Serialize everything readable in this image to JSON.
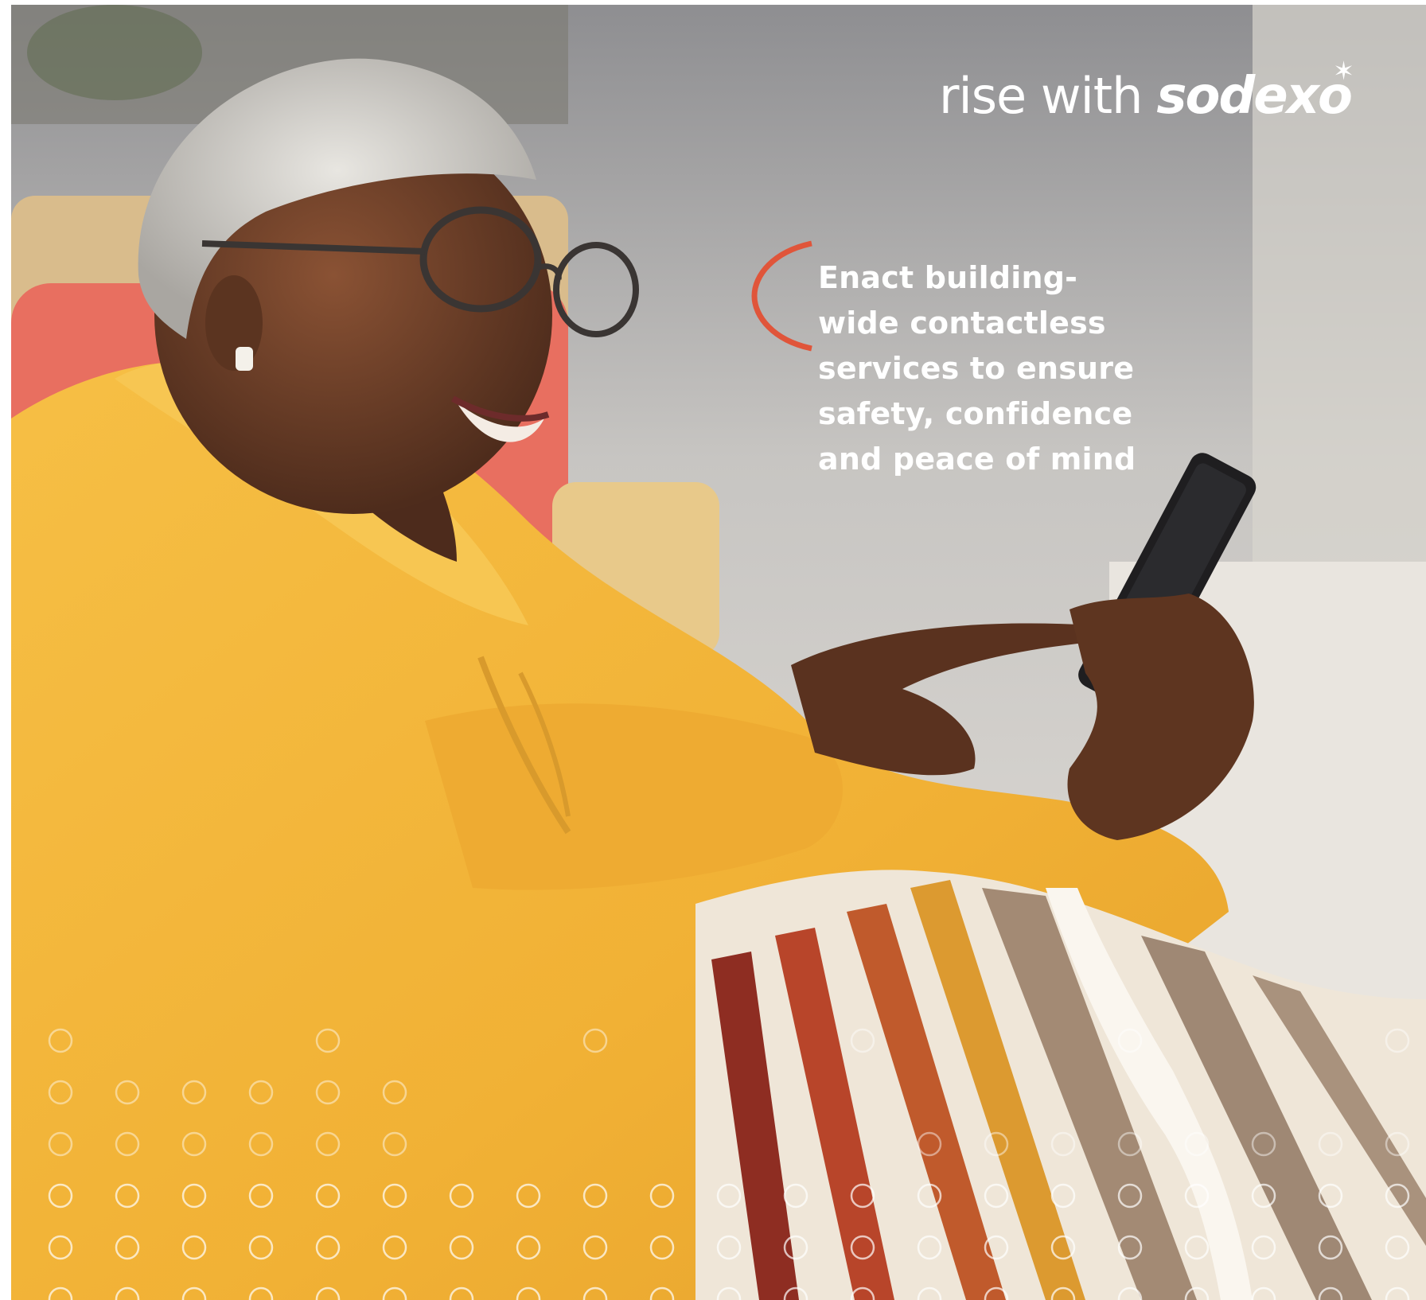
{
  "logo": {
    "prefix": "rise with",
    "brand": "sodexo",
    "star_glyph": "✶",
    "accent_color": "#e0553a"
  },
  "tagline": {
    "lines": [
      "Enact building-",
      "wide contactless",
      "services to ensure",
      "safety, confidence",
      "and peace of mind"
    ]
  },
  "icons": {
    "bracket": "open-bracket-icon",
    "dot_pattern": "circle-dot-pattern"
  },
  "colors": {
    "accent": "#e0553a",
    "hoodie": "#f2b437",
    "text": "#ffffff"
  }
}
